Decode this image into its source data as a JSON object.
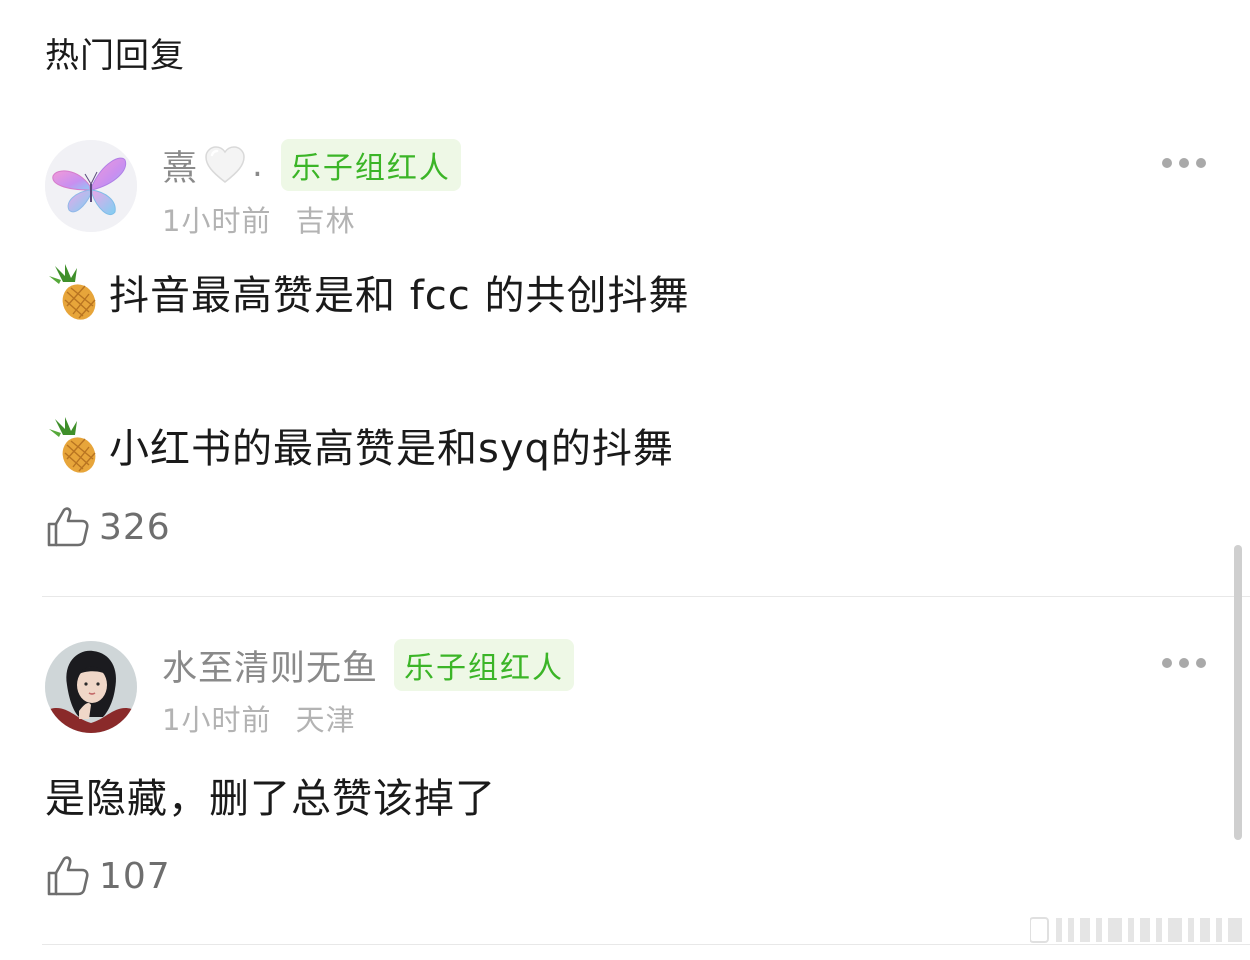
{
  "header": {
    "title": "热门回复"
  },
  "comments": [
    {
      "username": "熹",
      "username_suffix": ".",
      "badge": "乐子组红人",
      "time": "1小时前",
      "location": "吉林",
      "avatar_icon": "butterfly-icon",
      "lines": [
        "抖音最高赞是和 fcc 的共创抖舞",
        "小红书的最高赞是和syq的抖舞"
      ],
      "line_emoji": "pineapple-icon",
      "likes": "326"
    },
    {
      "username": "水至清则无鱼",
      "badge": "乐子组红人",
      "time": "1小时前",
      "location": "天津",
      "avatar_icon": "profile-photo",
      "lines": [
        "是隐藏，删了总赞该掉了"
      ],
      "likes": "107"
    }
  ],
  "colors": {
    "badge_text": "#3bb527",
    "badge_bg": "#eef8e6",
    "username": "#8a8a8a",
    "meta": "#b3b3b3",
    "body_text": "#1a1a1a"
  }
}
